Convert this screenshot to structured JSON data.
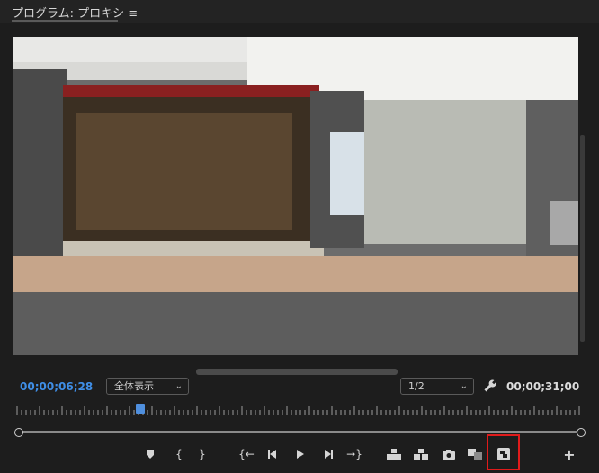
{
  "panel": {
    "title": "プログラム: プロキシ ≡"
  },
  "viewer": {
    "scene_description": "",
    "playhead_timecode": "00;00;06;28",
    "duration_timecode": "00;00;31;00",
    "fit_label": "全体表示",
    "resolution_label": "1/2"
  },
  "timeline": {
    "playhead_position": 0.213
  },
  "controls": {
    "items": [
      {
        "name": "add-marker-button",
        "icon": "marker-icon"
      },
      {
        "name": "mark-in-button",
        "icon": "in-icon"
      },
      {
        "name": "mark-out-button",
        "icon": "out-icon"
      },
      {
        "name": "go-to-in-button",
        "icon": "go-to-in-icon"
      },
      {
        "name": "step-back-button",
        "icon": "step-back-icon"
      },
      {
        "name": "play-button",
        "icon": "play-icon"
      },
      {
        "name": "step-forward-button",
        "icon": "step-forward-icon"
      },
      {
        "name": "go-to-out-button",
        "icon": "go-to-out-icon"
      },
      {
        "name": "lift-button",
        "icon": "lift-icon"
      },
      {
        "name": "extract-button",
        "icon": "extract-icon"
      },
      {
        "name": "export-frame-button",
        "icon": "camera-icon"
      },
      {
        "name": "comparison-view-button",
        "icon": "compare-icon"
      },
      {
        "name": "toggle-proxies-button",
        "icon": "proxy-icon"
      },
      {
        "name": "button-editor",
        "icon": "plus-icon"
      }
    ]
  },
  "colors": {
    "accent_blue": "#3f8ee6",
    "highlight_red": "#e11b1b"
  }
}
